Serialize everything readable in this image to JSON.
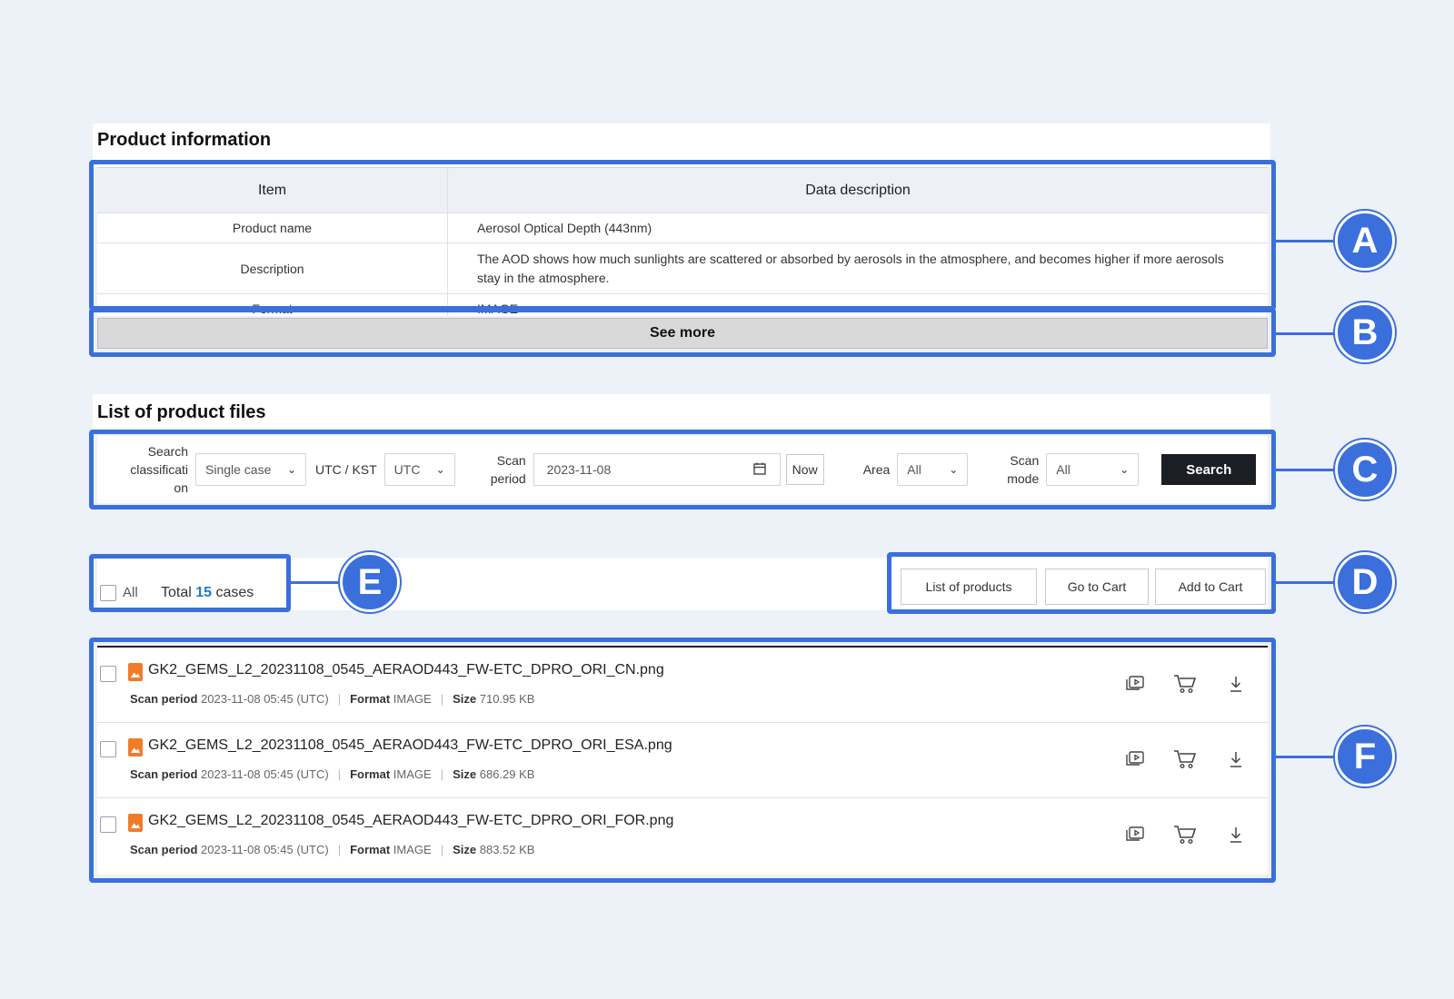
{
  "product_info": {
    "title": "Product information",
    "headers": {
      "item": "Item",
      "desc": "Data description"
    },
    "rows": [
      {
        "item": "Product name",
        "desc": "Aerosol Optical Depth (443nm)"
      },
      {
        "item": "Description",
        "desc": "The AOD shows how much sunlights are scattered or absorbed by aerosols in the atmosphere, and becomes higher if more aerosols stay in the atmosphere."
      },
      {
        "item": "Format",
        "desc": "IMAGE"
      }
    ],
    "see_more": "See more"
  },
  "file_list": {
    "title": "List of product files",
    "filters": {
      "search_class_label": "Search classificati on",
      "search_class_line1": "Search",
      "search_class_line2": "classificati",
      "search_class_line3": "on",
      "search_class_value": "Single case",
      "tz_label": "UTC / KST",
      "tz_value": "UTC",
      "scan_period_line1": "Scan",
      "scan_period_line2": "period",
      "date_value": "2023-11-08",
      "now_label": "Now",
      "area_label": "Area",
      "area_value": "All",
      "scan_mode_line1": "Scan",
      "scan_mode_line2": "mode",
      "scan_mode_value": "All",
      "search_label": "Search"
    },
    "toolbar": {
      "all_label": "All",
      "total_prefix": "Total",
      "total_count": "15",
      "total_suffix": "cases",
      "list_products": "List of products",
      "go_to_cart": "Go to Cart",
      "add_to_cart": "Add to Cart"
    },
    "meta_labels": {
      "scan_period": "Scan period",
      "format": "Format",
      "size": "Size"
    },
    "files": [
      {
        "name": "GK2_GEMS_L2_20231108_0545_AERAOD443_FW-ETC_DPRO_ORI_CN.png",
        "scan": "2023-11-08 05:45 (UTC)",
        "format": "IMAGE",
        "size": "710.95 KB"
      },
      {
        "name": "GK2_GEMS_L2_20231108_0545_AERAOD443_FW-ETC_DPRO_ORI_ESA.png",
        "scan": "2023-11-08 05:45 (UTC)",
        "format": "IMAGE",
        "size": "686.29 KB"
      },
      {
        "name": "GK2_GEMS_L2_20231108_0545_AERAOD443_FW-ETC_DPRO_ORI_FOR.png",
        "scan": "2023-11-08 05:45 (UTC)",
        "format": "IMAGE",
        "size": "883.52 KB"
      }
    ]
  },
  "annotations": {
    "a": "A",
    "b": "B",
    "c": "C",
    "d": "D",
    "e": "E",
    "f": "F"
  },
  "colors": {
    "accent": "#3a6fdc",
    "count": "#1a7bd0",
    "file_icon": "#f07c2a",
    "search_button": "#1b1e24"
  }
}
